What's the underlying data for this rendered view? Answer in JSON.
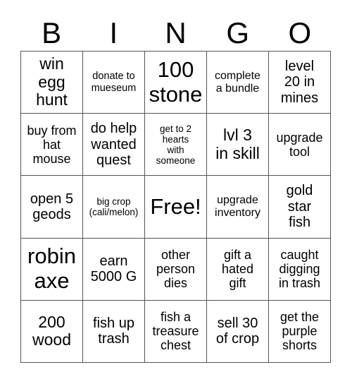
{
  "header": {
    "letters": [
      "B",
      "I",
      "N",
      "G",
      "O"
    ]
  },
  "cells": [
    [
      "win egg hunt",
      "donate to mueseum",
      "100 stone",
      "complete a bundle",
      "level 20 in mines"
    ],
    [
      "buy from hat mouse",
      "do help wanted quest",
      "get to 2 hearts with someone",
      "lvl 3 in skill",
      "upgrade tool"
    ],
    [
      "open 5 geods",
      "big crop (cali/melon)",
      "Free!",
      "upgrade inventory",
      "gold star fish"
    ],
    [
      "robin axe",
      "earn 5000 G",
      "other person dies",
      "gift a hated gift",
      "caught digging in trash"
    ],
    [
      "200 wood",
      "fish up trash",
      "fish a treasure chest",
      "sell 30 of crop",
      "get the purple shorts"
    ]
  ],
  "cell_lines": [
    [
      [
        "win",
        "egg",
        "hunt"
      ],
      [
        "donate to",
        "mueseum"
      ],
      [
        "100",
        "stone"
      ],
      [
        "complete",
        "a bundle"
      ],
      [
        "level",
        "20 in",
        "mines"
      ]
    ],
    [
      [
        "buy from",
        "hat",
        "mouse"
      ],
      [
        "do help",
        "wanted",
        "quest"
      ],
      [
        "get to 2",
        "hearts",
        "with",
        "someone"
      ],
      [
        "lvl 3",
        "in skill"
      ],
      [
        "upgrade",
        "tool"
      ]
    ],
    [
      [
        "open 5",
        "geods"
      ],
      [
        "big crop",
        "(cali/melon)"
      ],
      [
        "Free!"
      ],
      [
        "upgrade",
        "inventory"
      ],
      [
        "gold",
        "star",
        "fish"
      ]
    ],
    [
      [
        "robin",
        "axe"
      ],
      [
        "earn",
        "5000 G"
      ],
      [
        "other",
        "person",
        "dies"
      ],
      [
        "gift a",
        "hated",
        "gift"
      ],
      [
        "caught",
        "digging",
        "in trash"
      ]
    ],
    [
      [
        "200",
        "wood"
      ],
      [
        "fish up",
        "trash"
      ],
      [
        "fish a",
        "treasure",
        "chest"
      ],
      [
        "sell 30",
        "of crop"
      ],
      [
        "get the",
        "purple",
        "shorts"
      ]
    ]
  ]
}
